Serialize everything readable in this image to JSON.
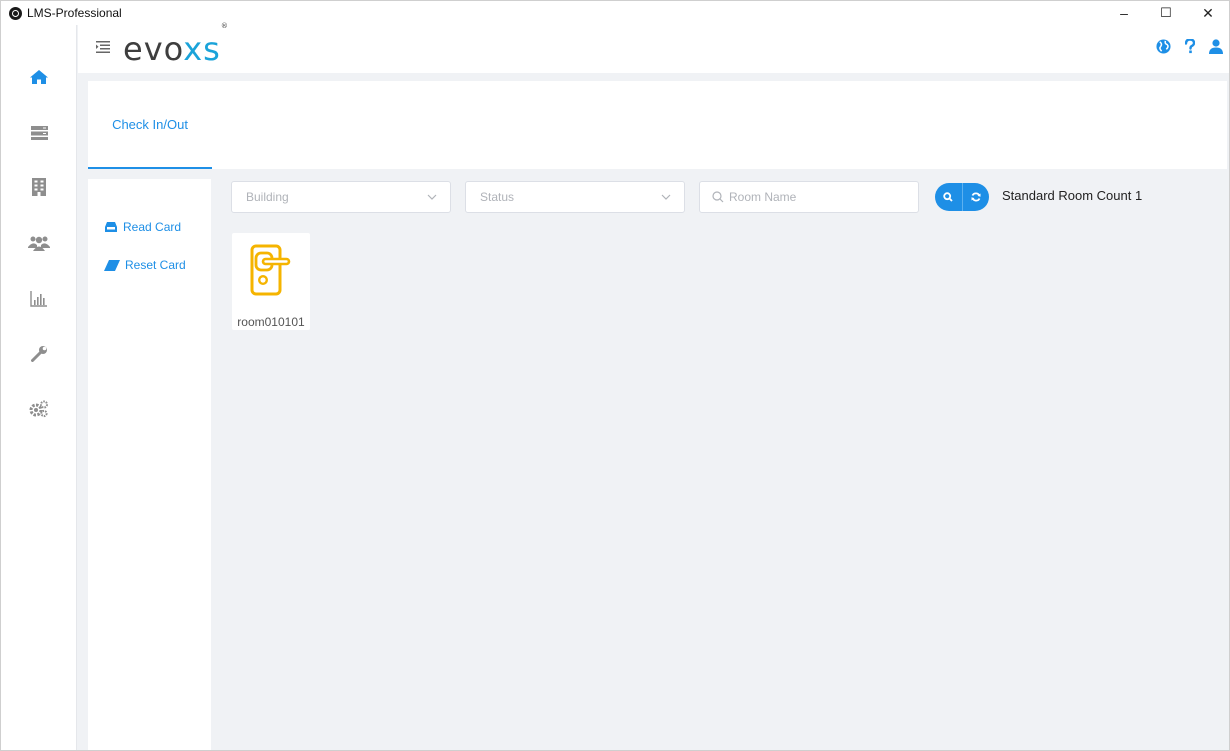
{
  "window": {
    "title": "LMS-Professional",
    "controls": {
      "minimize": "–",
      "maximize": "☐",
      "close": "✕"
    }
  },
  "rail": {
    "items": [
      {
        "icon": "home-icon",
        "active": true
      },
      {
        "icon": "server-icon"
      },
      {
        "icon": "building-icon"
      },
      {
        "icon": "users-icon"
      },
      {
        "icon": "bar-chart-icon"
      },
      {
        "icon": "wrench-icon"
      },
      {
        "icon": "gears-icon"
      }
    ]
  },
  "header": {
    "brand_main": "evo",
    "brand_accent": "xs",
    "brand_mark": "®",
    "icons": [
      "globe-icon",
      "help-icon",
      "user-icon"
    ]
  },
  "tabs": [
    {
      "label": "Check In/Out",
      "active": true
    }
  ],
  "side_actions": [
    {
      "label": "Read Card",
      "icon": "card-reader-icon"
    },
    {
      "label": "Reset Card",
      "icon": "eraser-icon"
    }
  ],
  "filters": {
    "building": {
      "placeholder": "Building"
    },
    "status": {
      "placeholder": "Status"
    },
    "room_name": {
      "placeholder": "Room Name"
    }
  },
  "room_count_label": "Standard Room Count 1",
  "rooms": [
    {
      "name": "room010101",
      "icon": "door-lock-icon"
    }
  ],
  "colors": {
    "accent": "#1e8fe6",
    "brand_accent": "#1aa3d9",
    "lock_icon": "#f5b400",
    "rail_active": "#1e8fe6",
    "rail_icon": "#8e8e8e"
  }
}
